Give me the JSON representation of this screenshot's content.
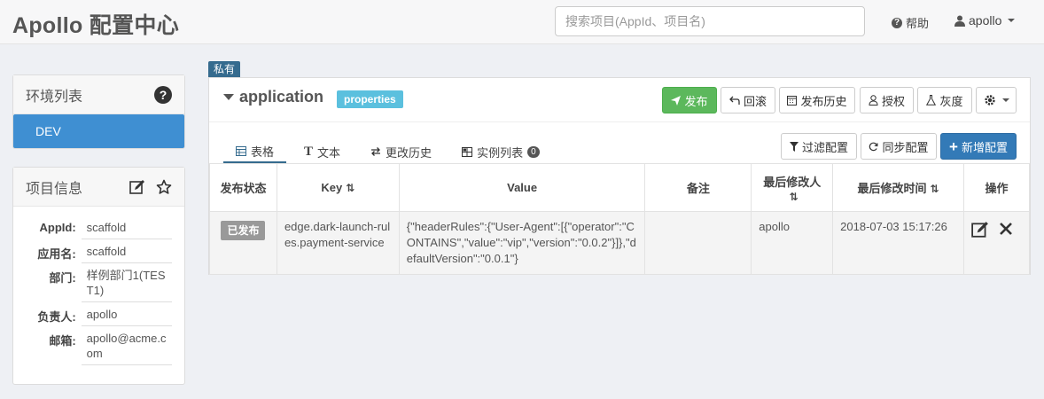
{
  "header": {
    "title": "Apollo 配置中心",
    "search_placeholder": "搜索项目(AppId、项目名)",
    "help_label": "帮助",
    "user_label": "apollo"
  },
  "env_panel": {
    "title": "环境列表",
    "items": [
      {
        "label": "DEV",
        "active": true
      }
    ]
  },
  "info_panel": {
    "title": "项目信息",
    "rows": [
      {
        "label": "AppId:",
        "value": "scaffold"
      },
      {
        "label": "应用名:",
        "value": "scaffold"
      },
      {
        "label": "部门:",
        "value": "样例部门1(TEST1)"
      },
      {
        "label": "负责人:",
        "value": "apollo"
      },
      {
        "label": "邮箱:",
        "value": "apollo@acme.com"
      }
    ]
  },
  "namespace": {
    "scope_tag": "私有",
    "name": "application",
    "format": "properties",
    "actions": {
      "publish": "发布",
      "rollback": "回滚",
      "history": "发布历史",
      "authorize": "授权",
      "gray": "灰度"
    },
    "tabs": [
      {
        "label": "表格",
        "active": true
      },
      {
        "label": "文本",
        "active": false
      },
      {
        "label": "更改历史",
        "active": false
      },
      {
        "label": "实例列表",
        "active": false,
        "count": "0"
      }
    ],
    "tools": {
      "filter": "过滤配置",
      "sync": "同步配置",
      "add": "新增配置"
    },
    "table": {
      "headers": {
        "status": "发布状态",
        "key": "Key",
        "value": "Value",
        "comment": "备注",
        "modifier": "最后修改人",
        "modified_time": "最后修改时间",
        "ops": "操作"
      },
      "rows": [
        {
          "status": "已发布",
          "key": "edge.dark-launch-rules.payment-service",
          "value": "{\"headerRules\":{\"User-Agent\":[{\"operator\":\"CONTAINS\",\"value\":\"vip\",\"version\":\"0.0.2\"}]},\"defaultVersion\":\"0.0.1\"}",
          "comment": "",
          "modifier": "apollo",
          "modified_time": "2018-07-03 15:17:26"
        }
      ]
    }
  },
  "colors": {
    "publish_green": "#5cb85c",
    "env_active_blue": "#3f8fd2",
    "add_button_blue": "#337ab7",
    "format_badge": "#5bc0de",
    "scope_tag": "#356b8e"
  }
}
